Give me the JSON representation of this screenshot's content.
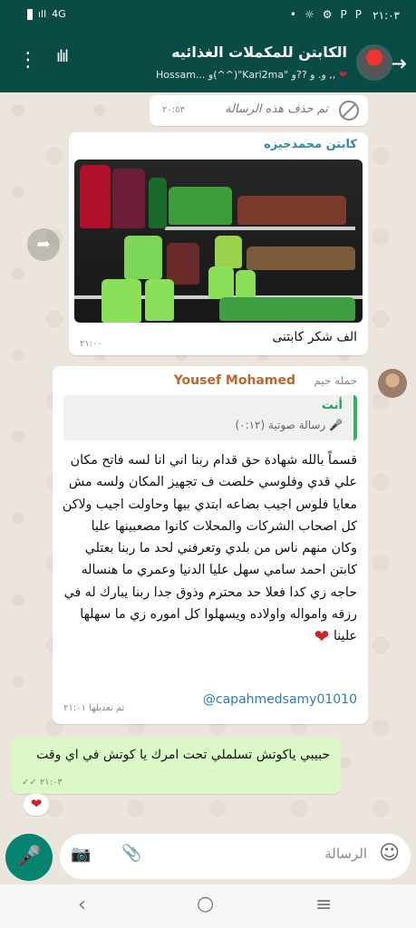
{
  "status_bar": {
    "time": "٢١:٠٣",
    "network": "4G",
    "signal": "ıll",
    "right_icons": [
      "•",
      "☼",
      "⚙",
      "P",
      "P"
    ]
  },
  "header": {
    "title": "الكابتن للمكملات الغذائيه",
    "subtitle": "Hossam... و(^^)\"Kari2ma\" و. و ??و ,,",
    "heart": "❤"
  },
  "messages": {
    "deleted": {
      "text": "تم حذف هذه الرسالة",
      "time": "٢٠:٥٣"
    },
    "image_msg": {
      "sender": "كابتن محمدجيزه",
      "caption": "الف شكر كابتنى",
      "time": "٢١:٠٠"
    },
    "big_msg": {
      "sender_name": "Yousef Mohamed",
      "sender_group": "جمله جيم",
      "quote_name": "أنت",
      "quote_text": "رسالة صوتية (٠:١٢)",
      "body": "قسماً بالله شهادة حق قدام ربنا اني انا لسه فاتح مكان علي قدي وفلوسي خلصت ف تجهيز المكان ولسه مش معايا فلوس اجيب بضاعه ابتدي بيها وحاولت اجيب ولاكن كل اصحاب الشركات والمحلات كانوا مصعبينها عليا وكان منهم ناس من بلدي وتعرفني لحد ما ربنا بعتلي كابتن احمد سامي سهل عليا الدنيا وعمري ما هنساله حاجه زي كدا فعلا حد محترم وذوق جدا ربنا يبارك له في رزقه وامواله واولاده ويسهلوا كل اموره زي ما سهلها علينا",
      "heart": "❤",
      "mention": "@capahmedsamy01010",
      "edited": "تم تعديلها ٢١:٠١"
    },
    "outgoing": {
      "text": "حبيبي ياكوتش تسلملي تحت امرك يا كوتش في اي وقت",
      "time": "٢١:٠٣",
      "ticks": "✓✓",
      "reaction": "❤"
    }
  },
  "input": {
    "placeholder": "الرسالة",
    "mic_icon": "🎤",
    "camera_icon": "📷",
    "clip_icon": "📎",
    "emoji_icon": "☺"
  },
  "nav": {
    "back": "‹",
    "home": "○",
    "recents": "≡"
  },
  "colors": {
    "header": "#0b4b45",
    "outgoing": "#dcf8c6",
    "accent": "#06846f"
  }
}
